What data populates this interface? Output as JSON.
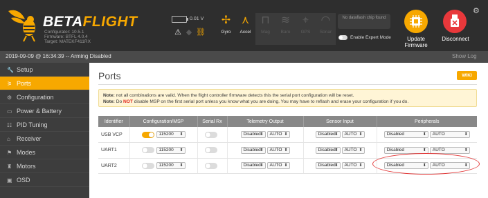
{
  "header": {
    "logo": {
      "word_beta": "BETA",
      "word_flight": "FLIGHT"
    },
    "fw_info": [
      "Configurator: 10.5.1",
      "Firmware: BTFL 4.0.4",
      "Target: MATEKF411RX"
    ],
    "battery_voltage": "0.01 V",
    "sensors": [
      {
        "label": "Gyro",
        "icon": "gyro-icon",
        "active": true
      },
      {
        "label": "Accel",
        "icon": "accel-icon",
        "active": true
      },
      {
        "label": "Mag",
        "icon": "mag-icon",
        "active": false
      },
      {
        "label": "Baro",
        "icon": "baro-icon",
        "active": false
      },
      {
        "label": "GPS",
        "icon": "gps-icon",
        "active": false
      },
      {
        "label": "Sonar",
        "icon": "sonar-icon",
        "active": false
      }
    ],
    "dataflash": "No dataflash chip found",
    "expert_mode_label": "Enable Expert Mode",
    "update_firmware_label": [
      "Update",
      "Firmware"
    ],
    "disconnect_label": "Disconnect",
    "colors": {
      "accent": "#f7a800",
      "disconnect": "#e8383b",
      "header_bg": "#2e2e2e"
    }
  },
  "statusbar": {
    "text": "2019-09-09 @ 16:34:39 -- Arming Disabled",
    "show_log": "Show Log"
  },
  "sidebar": {
    "items": [
      {
        "label": "Setup",
        "icon": "wrench-icon",
        "active": false
      },
      {
        "label": "Ports",
        "icon": "ports-icon",
        "active": true
      },
      {
        "label": "Configuration",
        "icon": "gear-icon",
        "active": false
      },
      {
        "label": "Power & Battery",
        "icon": "battery-icon",
        "active": false
      },
      {
        "label": "PID Tuning",
        "icon": "sliders-icon",
        "active": false
      },
      {
        "label": "Receiver",
        "icon": "receiver-icon",
        "active": false
      },
      {
        "label": "Modes",
        "icon": "flag-icon",
        "active": false
      },
      {
        "label": "Motors",
        "icon": "motor-icon",
        "active": false
      },
      {
        "label": "OSD",
        "icon": "osd-icon",
        "active": false
      }
    ]
  },
  "main": {
    "title": "Ports",
    "wiki_label": "WIKI",
    "note": {
      "line1_prefix": "Note:",
      "line1_text": " not all combinations are valid. When the flight controller firmware detects this the serial port configuration will be reset.",
      "line2_prefix": "Note:",
      "line2_pre": " Do ",
      "line2_not": "NOT",
      "line2_post": " disable MSP on the first serial port unless you know what you are doing. You may have to reflash and erase your configuration if you do."
    },
    "table": {
      "headers": [
        "Identifier",
        "Configuration/MSP",
        "Serial Rx",
        "Telemetry Output",
        "Sensor Input",
        "Peripherals"
      ],
      "rows": [
        {
          "identifier": "USB VCP",
          "msp_on": true,
          "baud": "115200",
          "serial_rx_on": false,
          "telemetry": "Disabled",
          "telemetry_baud": "AUTO",
          "sensor": "Disabled",
          "sensor_baud": "AUTO",
          "peripherals": "Disabled",
          "peripherals_baud": "AUTO"
        },
        {
          "identifier": "UART1",
          "msp_on": false,
          "baud": "115200",
          "serial_rx_on": false,
          "telemetry": "Disabled",
          "telemetry_baud": "AUTO",
          "sensor": "Disabled",
          "sensor_baud": "AUTO",
          "peripherals": "Disabled",
          "peripherals_baud": "AUTO"
        },
        {
          "identifier": "UART2",
          "msp_on": false,
          "baud": "115200",
          "serial_rx_on": false,
          "telemetry": "Disabled",
          "telemetry_baud": "AUTO",
          "sensor": "Disabled",
          "sensor_baud": "AUTO",
          "peripherals": "Disabled",
          "peripherals_baud": "AUTO"
        }
      ]
    }
  }
}
